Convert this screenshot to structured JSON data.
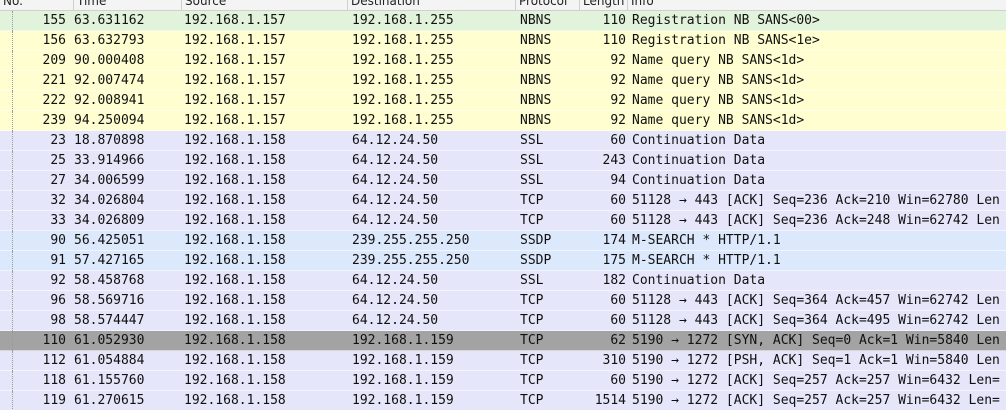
{
  "columns": {
    "no": "No.",
    "time": "Time",
    "source": "Source",
    "destination": "Destination",
    "protocol": "Protocol",
    "length": "Length",
    "info": "Info"
  },
  "colors": {
    "nbns": "#fefed0",
    "nbns_first": "#e2f3dc",
    "ssl_tcp": "#e6e6fa",
    "ssdp": "#dce8fb",
    "selected": "#a3a3a3"
  },
  "packets": [
    {
      "no": "155",
      "time": "63.631162",
      "source": "192.168.1.157",
      "destination": "192.168.1.255",
      "protocol": "NBNS",
      "length": "110",
      "info": "Registration NB SANS<00>",
      "color": "#e2f3dc"
    },
    {
      "no": "156",
      "time": "63.632793",
      "source": "192.168.1.157",
      "destination": "192.168.1.255",
      "protocol": "NBNS",
      "length": "110",
      "info": "Registration NB SANS<1e>",
      "color": "#fefed0"
    },
    {
      "no": "209",
      "time": "90.000408",
      "source": "192.168.1.157",
      "destination": "192.168.1.255",
      "protocol": "NBNS",
      "length": "92",
      "info": "Name query NB SANS<1d>",
      "color": "#fefed0"
    },
    {
      "no": "221",
      "time": "92.007474",
      "source": "192.168.1.157",
      "destination": "192.168.1.255",
      "protocol": "NBNS",
      "length": "92",
      "info": "Name query NB SANS<1d>",
      "color": "#fefed0"
    },
    {
      "no": "222",
      "time": "92.008941",
      "source": "192.168.1.157",
      "destination": "192.168.1.255",
      "protocol": "NBNS",
      "length": "92",
      "info": "Name query NB SANS<1d>",
      "color": "#fefed0"
    },
    {
      "no": "239",
      "time": "94.250094",
      "source": "192.168.1.157",
      "destination": "192.168.1.255",
      "protocol": "NBNS",
      "length": "92",
      "info": "Name query NB SANS<1d>",
      "color": "#fefed0"
    },
    {
      "no": "23",
      "time": "18.870898",
      "source": "192.168.1.158",
      "destination": "64.12.24.50",
      "protocol": "SSL",
      "length": "60",
      "info": "Continuation Data",
      "color": "#e6e6fa"
    },
    {
      "no": "25",
      "time": "33.914966",
      "source": "192.168.1.158",
      "destination": "64.12.24.50",
      "protocol": "SSL",
      "length": "243",
      "info": "Continuation Data",
      "color": "#e6e6fa"
    },
    {
      "no": "27",
      "time": "34.006599",
      "source": "192.168.1.158",
      "destination": "64.12.24.50",
      "protocol": "SSL",
      "length": "94",
      "info": "Continuation Data",
      "color": "#e6e6fa"
    },
    {
      "no": "32",
      "time": "34.026804",
      "source": "192.168.1.158",
      "destination": "64.12.24.50",
      "protocol": "TCP",
      "length": "60",
      "info": "51128 → 443 [ACK] Seq=236 Ack=210 Win=62780 Len",
      "color": "#e6e6fa"
    },
    {
      "no": "33",
      "time": "34.026809",
      "source": "192.168.1.158",
      "destination": "64.12.24.50",
      "protocol": "TCP",
      "length": "60",
      "info": "51128 → 443 [ACK] Seq=236 Ack=248 Win=62742 Len",
      "color": "#e6e6fa"
    },
    {
      "no": "90",
      "time": "56.425051",
      "source": "192.168.1.158",
      "destination": "239.255.255.250",
      "protocol": "SSDP",
      "length": "174",
      "info": "M-SEARCH * HTTP/1.1",
      "color": "#dce8fb"
    },
    {
      "no": "91",
      "time": "57.427165",
      "source": "192.168.1.158",
      "destination": "239.255.255.250",
      "protocol": "SSDP",
      "length": "175",
      "info": "M-SEARCH * HTTP/1.1",
      "color": "#dce8fb"
    },
    {
      "no": "92",
      "time": "58.458768",
      "source": "192.168.1.158",
      "destination": "64.12.24.50",
      "protocol": "SSL",
      "length": "182",
      "info": "Continuation Data",
      "color": "#e6e6fa"
    },
    {
      "no": "96",
      "time": "58.569716",
      "source": "192.168.1.158",
      "destination": "64.12.24.50",
      "protocol": "TCP",
      "length": "60",
      "info": "51128 → 443 [ACK] Seq=364 Ack=457 Win=62742 Len",
      "color": "#e6e6fa"
    },
    {
      "no": "98",
      "time": "58.574447",
      "source": "192.168.1.158",
      "destination": "64.12.24.50",
      "protocol": "TCP",
      "length": "60",
      "info": "51128 → 443 [ACK] Seq=364 Ack=495 Win=62742 Len",
      "color": "#e6e6fa"
    },
    {
      "no": "110",
      "time": "61.052930",
      "source": "192.168.1.158",
      "destination": "192.168.1.159",
      "protocol": "TCP",
      "length": "62",
      "info": "5190 → 1272 [SYN, ACK] Seq=0 Ack=1 Win=5840 Len",
      "color": "#a3a3a3",
      "selected": true
    },
    {
      "no": "112",
      "time": "61.054884",
      "source": "192.168.1.158",
      "destination": "192.168.1.159",
      "protocol": "TCP",
      "length": "310",
      "info": "5190 → 1272 [PSH, ACK] Seq=1 Ack=1 Win=5840 Len",
      "color": "#e6e6fa"
    },
    {
      "no": "118",
      "time": "61.155760",
      "source": "192.168.1.158",
      "destination": "192.168.1.159",
      "protocol": "TCP",
      "length": "60",
      "info": "5190 → 1272 [ACK] Seq=257 Ack=257 Win=6432 Len=",
      "color": "#e6e6fa"
    },
    {
      "no": "119",
      "time": "61.270615",
      "source": "192.168.1.158",
      "destination": "192.168.1.159",
      "protocol": "TCP",
      "length": "1514",
      "info": "5190 → 1272 [ACK] Seq=257 Ack=257 Win=6432 Len=",
      "color": "#e6e6fa"
    }
  ]
}
